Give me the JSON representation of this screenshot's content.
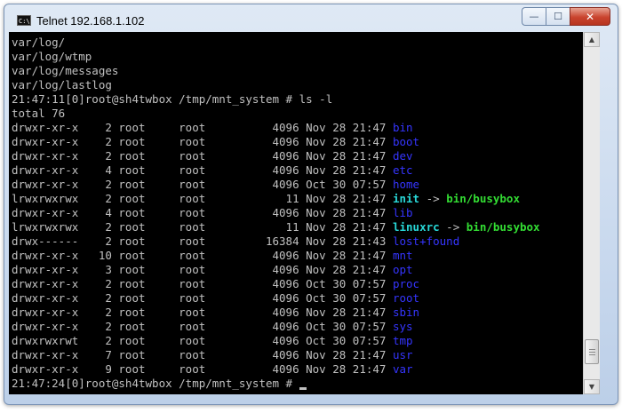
{
  "window": {
    "title": "Telnet 192.168.1.102",
    "icon_label": "C:\\",
    "controls": {
      "minimize": "—",
      "maximize": "☐",
      "close": "✕"
    }
  },
  "colors": {
    "console_bg": "#000000",
    "text": "#c0c0c0",
    "directory": "#3535ff",
    "symlink": "#28d8d8",
    "link_target": "#33dd33",
    "titlebar": "#c9d9ee",
    "close_button": "#c9442e"
  },
  "console": {
    "lines": [
      [
        {
          "t": "var/log/"
        }
      ],
      [
        {
          "t": "var/log/wtmp"
        }
      ],
      [
        {
          "t": "var/log/messages"
        }
      ],
      [
        {
          "t": "var/log/lastlog"
        }
      ],
      [
        {
          "t": "21:47:11[0]root@sh4twbox /tmp/mnt_system # ls -l"
        }
      ],
      [
        {
          "t": "total 76"
        }
      ],
      [
        {
          "t": "drwxr-xr-x    2 root     root          4096 Nov 28 21:47 "
        },
        {
          "t": "bin",
          "c": "dir"
        }
      ],
      [
        {
          "t": "drwxr-xr-x    2 root     root          4096 Nov 28 21:47 "
        },
        {
          "t": "boot",
          "c": "dir"
        }
      ],
      [
        {
          "t": "drwxr-xr-x    2 root     root          4096 Nov 28 21:47 "
        },
        {
          "t": "dev",
          "c": "dir"
        }
      ],
      [
        {
          "t": "drwxr-xr-x    4 root     root          4096 Nov 28 21:47 "
        },
        {
          "t": "etc",
          "c": "dir"
        }
      ],
      [
        {
          "t": "drwxr-xr-x    2 root     root          4096 Oct 30 07:57 "
        },
        {
          "t": "home",
          "c": "dir"
        }
      ],
      [
        {
          "t": "lrwxrwxrwx    2 root     root            11 Nov 28 21:47 "
        },
        {
          "t": "init",
          "c": "link"
        },
        {
          "t": " -> "
        },
        {
          "t": "bin/busybox",
          "c": "target"
        }
      ],
      [
        {
          "t": "drwxr-xr-x    4 root     root          4096 Nov 28 21:47 "
        },
        {
          "t": "lib",
          "c": "dir"
        }
      ],
      [
        {
          "t": "lrwxrwxrwx    2 root     root            11 Nov 28 21:47 "
        },
        {
          "t": "linuxrc",
          "c": "link"
        },
        {
          "t": " -> "
        },
        {
          "t": "bin/busybox",
          "c": "target"
        }
      ],
      [
        {
          "t": "drwx------    2 root     root         16384 Nov 28 21:43 "
        },
        {
          "t": "lost+found",
          "c": "dir"
        }
      ],
      [
        {
          "t": "drwxr-xr-x   10 root     root          4096 Nov 28 21:47 "
        },
        {
          "t": "mnt",
          "c": "dir"
        }
      ],
      [
        {
          "t": "drwxr-xr-x    3 root     root          4096 Nov 28 21:47 "
        },
        {
          "t": "opt",
          "c": "dir"
        }
      ],
      [
        {
          "t": "drwxr-xr-x    2 root     root          4096 Oct 30 07:57 "
        },
        {
          "t": "proc",
          "c": "dir"
        }
      ],
      [
        {
          "t": "drwxr-xr-x    2 root     root          4096 Oct 30 07:57 "
        },
        {
          "t": "root",
          "c": "dir"
        }
      ],
      [
        {
          "t": "drwxr-xr-x    2 root     root          4096 Nov 28 21:47 "
        },
        {
          "t": "sbin",
          "c": "dir"
        }
      ],
      [
        {
          "t": "drwxr-xr-x    2 root     root          4096 Oct 30 07:57 "
        },
        {
          "t": "sys",
          "c": "dir"
        }
      ],
      [
        {
          "t": "drwxrwxrwt    2 root     root          4096 Oct 30 07:57 "
        },
        {
          "t": "tmp",
          "c": "dir"
        }
      ],
      [
        {
          "t": "drwxr-xr-x    7 root     root          4096 Nov 28 21:47 "
        },
        {
          "t": "usr",
          "c": "dir"
        }
      ],
      [
        {
          "t": "drwxr-xr-x    9 root     root          4096 Nov 28 21:47 "
        },
        {
          "t": "var",
          "c": "dir"
        }
      ],
      [
        {
          "t": "21:47:24[0]root@sh4twbox /tmp/mnt_system # "
        },
        {
          "cursor": true
        }
      ]
    ]
  },
  "scrollbar": {
    "up_arrow": "▲",
    "down_arrow": "▼",
    "position": 0.95
  }
}
